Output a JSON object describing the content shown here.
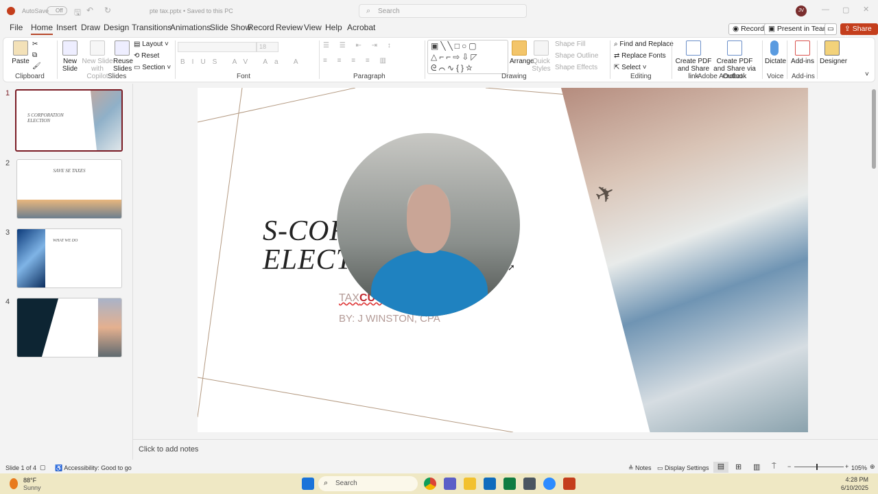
{
  "titlebar": {
    "autosave": "AutoSave",
    "autosave_state": "Off",
    "filename": "pte tax.pptx • Saved to this PC",
    "search_placeholder": "Search",
    "user_initials": "JV"
  },
  "tabs": [
    "File",
    "Home",
    "Insert",
    "Draw",
    "Design",
    "Transitions",
    "Animations",
    "Slide Show",
    "Record",
    "Review",
    "View",
    "Help",
    "Acrobat"
  ],
  "actions": {
    "record": "Record",
    "present": "Present in Teams",
    "share": "Share"
  },
  "ribbon": {
    "clipboard": {
      "paste": "Paste",
      "group": "Clipboard"
    },
    "slides": {
      "new_slide": "New Slide",
      "new_copilot": "New Slide with Copilot",
      "reuse": "Reuse Slides",
      "layout": "Layout",
      "reset": "Reset",
      "section": "Section",
      "group": "Slides"
    },
    "font": {
      "size": "18",
      "group": "Font"
    },
    "paragraph": {
      "group": "Paragraph"
    },
    "drawing": {
      "arrange": "Arrange",
      "quick_styles": "Quick Styles",
      "shape_fill": "Shape Fill",
      "shape_outline": "Shape Outline",
      "shape_effects": "Shape Effects",
      "group": "Drawing"
    },
    "editing": {
      "find_replace": "Find and Replace",
      "replace_fonts": "Replace Fonts",
      "select": "Select",
      "group": "Editing"
    },
    "acrobat": {
      "create_share": "Create PDF and Share link",
      "create_outlook": "Create PDF and Share via Outlook",
      "group": "Adobe Acrobat"
    },
    "voice": {
      "dictate": "Dictate",
      "group": "Voice"
    },
    "addins": {
      "addins": "Add-ins",
      "group": "Add-ins"
    },
    "designer": {
      "label": "Designer"
    }
  },
  "thumbnails": [
    {
      "num": "1",
      "title": "S CORPORATION ELECTION"
    },
    {
      "num": "2",
      "title": "SAVE SE TAXES"
    },
    {
      "num": "3",
      "title": "WHAT WE DO"
    },
    {
      "num": "4",
      "title": ""
    }
  ],
  "slide": {
    "title_line1": "S-CORPORATION",
    "title_line2": "ELECTION",
    "brand_tax": "TAX",
    "brand_cut": "CUT",
    "byline": "BY: J WINSTON, CPA",
    "accent": "#c0272d"
  },
  "notes": {
    "placeholder": "Click to add notes"
  },
  "status": {
    "slide": "Slide 1 of 4",
    "accessibility": "Accessibility: Good to go",
    "notes": "Notes",
    "display": "Display Settings",
    "zoom": "105%",
    "zoom_percent": 105
  },
  "taskbar": {
    "temp": "88°F",
    "weather": "Sunny",
    "search": "Search",
    "time": "4:28 PM",
    "date": "6/10/2025"
  }
}
